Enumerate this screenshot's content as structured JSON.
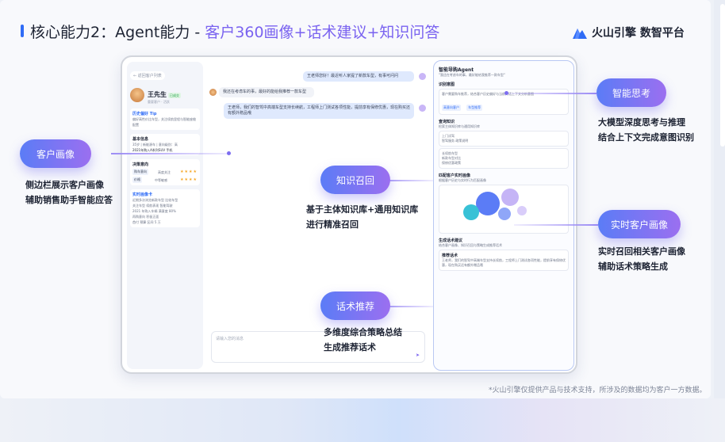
{
  "header": {
    "title_prefix": "核心能力2：Agent能力 - ",
    "title_accent": "客户360画像+话术建议+知识问答",
    "logo_text": "火山引擎 数智平台"
  },
  "left_panel": {
    "back": "← 返回客户列表",
    "customer_name": "王先生",
    "customer_tag": "已成交",
    "customer_sub": "重要客户 · 活跃",
    "card1_title": "历史偏好 Tip",
    "card1_text": "偏好高性价比车型，关注续航里程与智能座舱配置",
    "card2_title": "基本信息",
    "card2_line1": "35岁 | 新能源车 | 意向级别：高",
    "card2_line2": "2021年购入A系列SUV 手机",
    "card3_title": "决策意向",
    "card3_rows": [
      {
        "label": "购车意向",
        "value": "高度关注"
      },
      {
        "label": "价格",
        "value": "中等敏感"
      }
    ],
    "card4_title": "实时画像卡",
    "card4_lines": [
      "近期多次浏览新款车型 比较车型",
      "关注车型 续航表现 智能驾驶",
      "2021 年购入车辆 满意度 80%",
      "再购意向 积极正面",
      "首付 预算 区间 5 万"
    ]
  },
  "chat": {
    "msg1": "王老师您好！最近听人家提了新款车型，有事可问问",
    "msg2": "我还在考虑车的事，最好的能给我推荐一款车型",
    "msg3": "王老师，我们的智驾中高端车型支持长续航，工程师上门测试各项性能，提前享有保修优惠，现在购买还有额外赠品哦",
    "input_placeholder": "请输入您的消息",
    "send_icon": "➤"
  },
  "agent_panel": {
    "title": "智能导购Agent",
    "intro": "\"我还在考虑车的事，最好能给我推荐一款车型\"",
    "sec1_title": "识别意图",
    "sec1_text": "客户需要购车推荐，结合客户历史偏好与当前对话上下文分析意图",
    "sec1_pills": [
      "高意向客户",
      "车型推荐"
    ],
    "sec2_title": "查询知识",
    "sec2_text": "检索主体知识库与通用知识库",
    "sec2_box1": [
      "上门试驾",
      "智驾服务 政策说明"
    ],
    "sec2_box2": [
      "长续航车型",
      "新款车型对比",
      "保修优惠政策"
    ],
    "sec3_title": "匹配客户实时画像",
    "sec3_text": "根据客户历史与实时行为匹配画像",
    "sec4_title": "生成话术建议",
    "sec4_text": "结合客户画像、知识召回与策略生成推荐话术",
    "sec4_answer_label": "推荐话术",
    "sec4_answer": "王老师，我们的智驾中高端车型支持长续航，工程师上门测试各项性能，提前享有保修优惠，现在购买还有额外赠品哦"
  },
  "annotations": {
    "customer_portrait": {
      "label": "客户画像",
      "line1": "侧边栏展示客户画像",
      "line2": "辅助销售助手智能应答"
    },
    "knowledge_recall": {
      "label": "知识召回",
      "line1": "基于主体知识库+通用知识库",
      "line2": "进行精准召回"
    },
    "script_recommend": {
      "label": "话术推荐",
      "line1": "多维度综合策略总结",
      "line2": "生成推荐话术"
    },
    "smart_thinking": {
      "label": "智能思考",
      "line1": "大模型深度思考与推理",
      "line2": "结合上下文完成意图识别"
    },
    "realtime_portrait": {
      "label": "实时客户画像",
      "line1": "实时召回相关客户画像",
      "line2": "辅助话术策略生成"
    }
  },
  "footnote": "*火山引擎仅提供产品与技术支持，所涉及的数据均为客户一方数据。"
}
